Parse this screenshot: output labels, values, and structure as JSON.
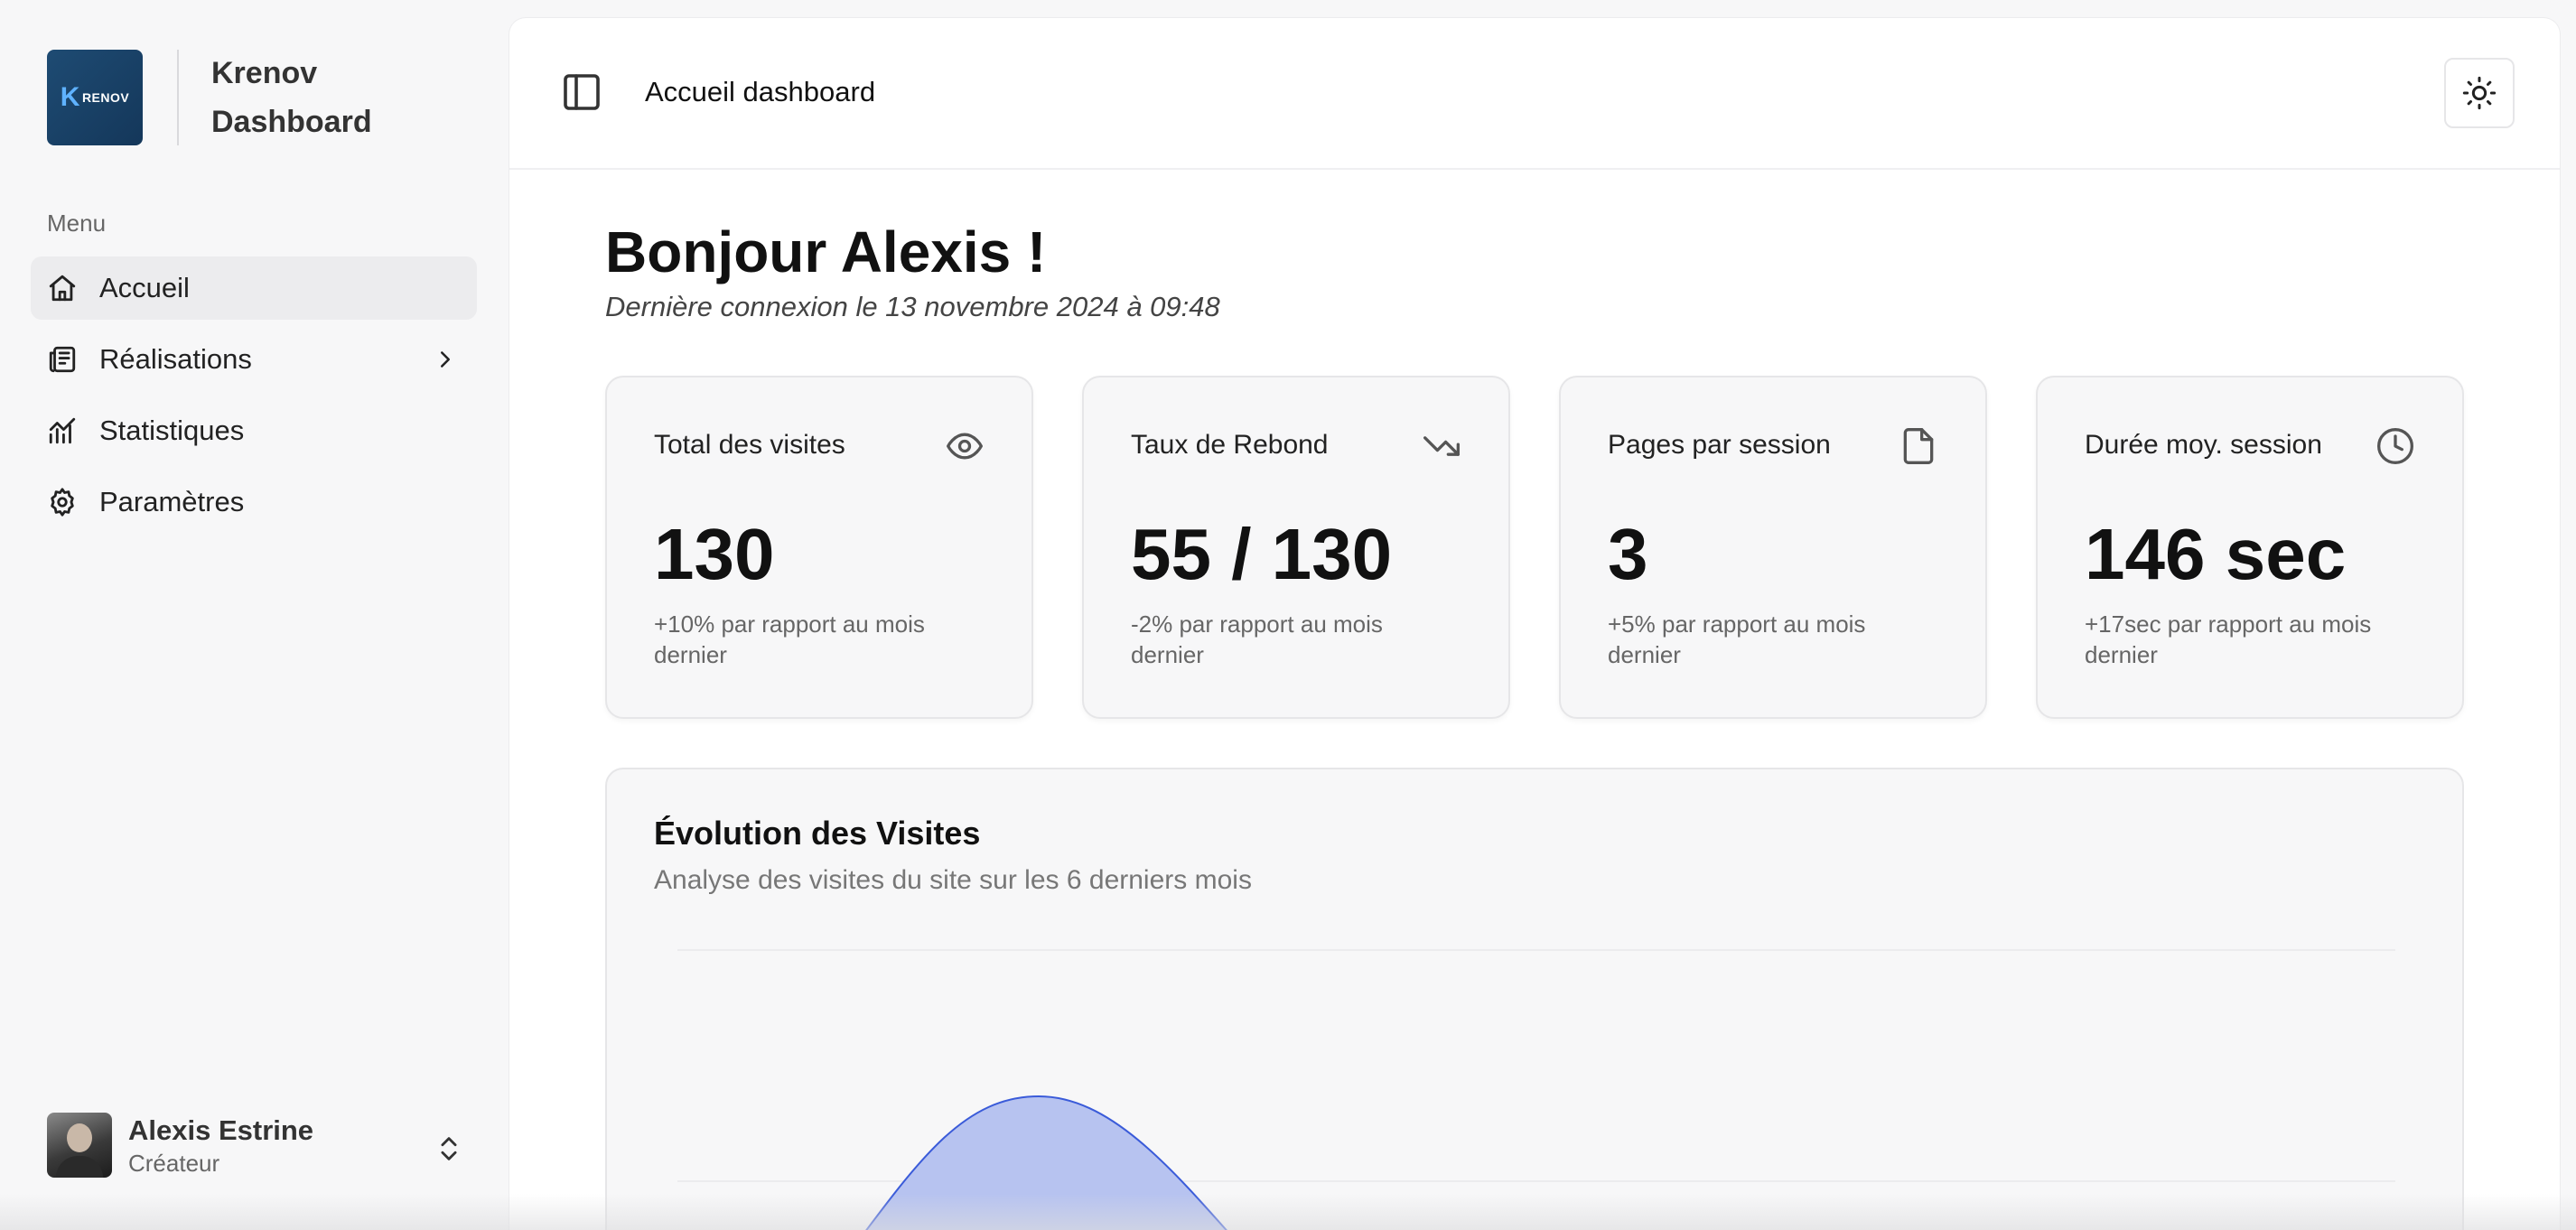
{
  "brand": {
    "logo_letter": "K",
    "logo_text": "RENOV",
    "name_line1": "Krenov",
    "name_line2": "Dashboard"
  },
  "sidebar": {
    "menu_label": "Menu",
    "items": [
      {
        "label": "Accueil",
        "icon": "home-icon",
        "active": true
      },
      {
        "label": "Réalisations",
        "icon": "newspaper-icon",
        "has_submenu": true
      },
      {
        "label": "Statistiques",
        "icon": "chart-line-icon"
      },
      {
        "label": "Paramètres",
        "icon": "gear-icon"
      }
    ]
  },
  "user": {
    "name": "Alexis Estrine",
    "role": "Créateur"
  },
  "topbar": {
    "title": "Accueil dashboard"
  },
  "greeting": {
    "title": "Bonjour Alexis !",
    "last_login": "Dernière connexion le 13 novembre 2024 à 09:48"
  },
  "stats": [
    {
      "title": "Total des visites",
      "value": "130",
      "note": "+10% par rapport au mois dernier",
      "icon": "eye-icon"
    },
    {
      "title": "Taux de Rebond",
      "value": "55 / 130",
      "note": "-2% par rapport au mois dernier",
      "icon": "trending-down-icon"
    },
    {
      "title": "Pages par session",
      "value": "3",
      "note": "+5% par rapport au mois dernier",
      "icon": "file-icon"
    },
    {
      "title": "Durée moy. session",
      "value": "146 sec",
      "note": "+17sec par rapport au mois dernier",
      "icon": "clock-icon"
    }
  ],
  "chart": {
    "title": "Évolution des Visites",
    "subtitle": "Analyse des visites du site sur les 6 derniers mois",
    "fill_color": "#b7c3f0",
    "stroke_color": "#3a5bd9"
  },
  "colors": {
    "accent": "#3a5bd9",
    "logo_bg": "#1e4b73"
  }
}
